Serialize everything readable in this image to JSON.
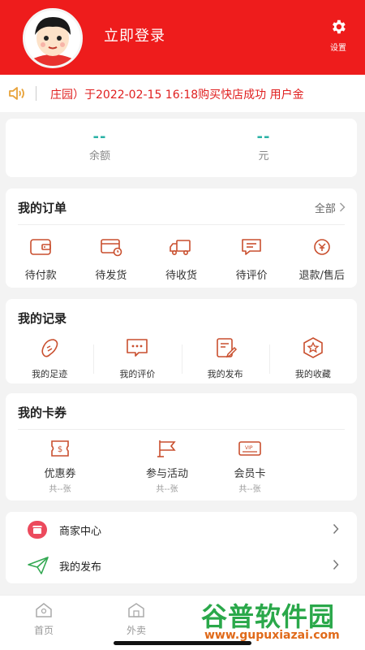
{
  "header": {
    "login_label": "立即登录",
    "settings_label": "设置",
    "brand_color": "#ee1c1c"
  },
  "notice": {
    "text": "庄园）于2022-02-15 16:18购买快店成功   用户金"
  },
  "balance": {
    "left": {
      "value": "--",
      "label": "余额"
    },
    "right": {
      "value": "--",
      "label": "元"
    }
  },
  "orders": {
    "title": "我的订单",
    "all_label": "全部",
    "items": [
      {
        "label": "待付款",
        "icon": "wallet-icon"
      },
      {
        "label": "待发货",
        "icon": "card-clock-icon"
      },
      {
        "label": "待收货",
        "icon": "truck-icon"
      },
      {
        "label": "待评价",
        "icon": "comment-icon"
      },
      {
        "label": "退款/售后",
        "icon": "refund-icon"
      }
    ]
  },
  "records": {
    "title": "我的记录",
    "items": [
      {
        "label": "我的足迹",
        "icon": "footprint-icon"
      },
      {
        "label": "我的评价",
        "icon": "review-icon"
      },
      {
        "label": "我的发布",
        "icon": "publish-edit-icon"
      },
      {
        "label": "我的收藏",
        "icon": "star-icon"
      }
    ]
  },
  "coupons": {
    "title": "我的卡券",
    "items": [
      {
        "label": "优惠券",
        "sub": "共--张",
        "icon": "coupon-icon"
      },
      {
        "label": "参与活动",
        "sub": "共--张",
        "icon": "flag-icon"
      },
      {
        "label": "会员卡",
        "sub": "共--张",
        "icon": "vip-card-icon"
      }
    ]
  },
  "menu": [
    {
      "label": "商家中心",
      "icon": "store-icon"
    },
    {
      "label": "我的发布",
      "icon": "paper-plane-icon"
    }
  ],
  "tabbar": [
    {
      "label": "首页",
      "icon": "home-icon"
    },
    {
      "label": "外卖",
      "icon": "takeout-icon"
    }
  ],
  "watermark": {
    "big": "谷普软件园",
    "small": "www.gupuxiazai.com"
  }
}
